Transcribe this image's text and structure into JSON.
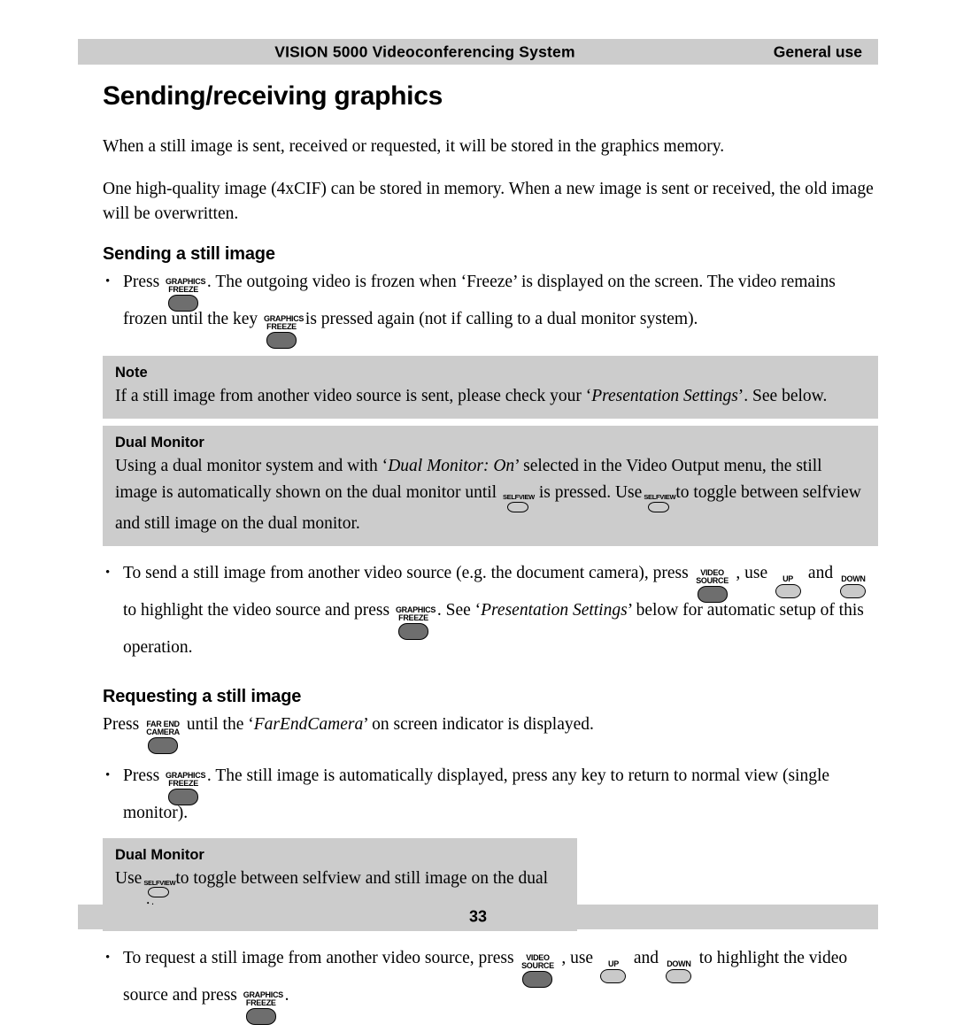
{
  "header": {
    "title": "VISION 5000 Videoconferencing System",
    "section": "General use"
  },
  "footer": {
    "page_number": "33"
  },
  "page": {
    "title": "Sending/receiving graphics",
    "intro_1": "When a still image is sent, received or requested, it will be stored in the graphics memory.",
    "intro_2": "One high-quality image (4xCIF) can be stored in memory. When a new image is sent or received, the old image will be overwritten."
  },
  "keys": {
    "graphics_freeze": {
      "line1": "GRAPHICS",
      "line2": "FREEZE",
      "style": "dark"
    },
    "video_source": {
      "line1": "VIDEO",
      "line2": "SOURCE",
      "style": "dark"
    },
    "far_end_camera": {
      "line1": "FAR END",
      "line2": "CAMERA",
      "style": "dark"
    },
    "up": {
      "line1": "UP",
      "line2": "",
      "style": "light"
    },
    "down": {
      "line1": "DOWN",
      "line2": "",
      "style": "light"
    },
    "selfview": {
      "line1": "SELFVIEW",
      "line2": "",
      "style": "hollow"
    }
  },
  "sending": {
    "heading": "Sending a still image",
    "b1_a": "Press",
    "b1_b": ". The outgoing video is frozen when ‘Freeze’ is displayed on the screen. The video remains frozen until the key",
    "b1_c": "is pressed again (not if calling to a dual monitor system).",
    "note": {
      "caption": "Note",
      "text_a": "If a still image from another video source is sent, please check your ‘",
      "text_em": "Presentation Settings",
      "text_b": "’. See below."
    },
    "dual": {
      "caption": "Dual Monitor",
      "text_a": "Using a dual monitor system and with ‘",
      "text_em": "Dual Monitor: On",
      "text_b": "’ selected in the Video Output menu, the still image is automatically shown on the dual monitor until",
      "text_c": "is pressed. Use",
      "text_d": "to toggle between selfview and still image on the dual monitor."
    },
    "b2_a": "To send a still image from another video source (e.g. the document camera), press",
    "b2_b": ", use",
    "b2_c": "and",
    "b2_d": "to highlight the video source and press",
    "b2_e": ". See ‘",
    "b2_em": "Presentation Settings",
    "b2_f": "’ below for automatic setup of this operation."
  },
  "requesting": {
    "heading": "Requesting a still image",
    "line_a": "Press",
    "line_b": "until the ‘",
    "line_em": "FarEndCamera",
    "line_c": "’ on screen indicator is displayed.",
    "b1_a": "Press",
    "b1_b": ". The still image is automatically displayed, press any key to return to normal view (single monitor).",
    "dual": {
      "caption": "Dual Monitor",
      "text_a": "Use",
      "text_b": "to toggle between selfview and still image on the dual monitor."
    },
    "b2_a": "To request a still image from another video source, press",
    "b2_b": ", use",
    "b2_c": "and",
    "b2_d": "to highlight the video source and press",
    "b2_e": "."
  }
}
